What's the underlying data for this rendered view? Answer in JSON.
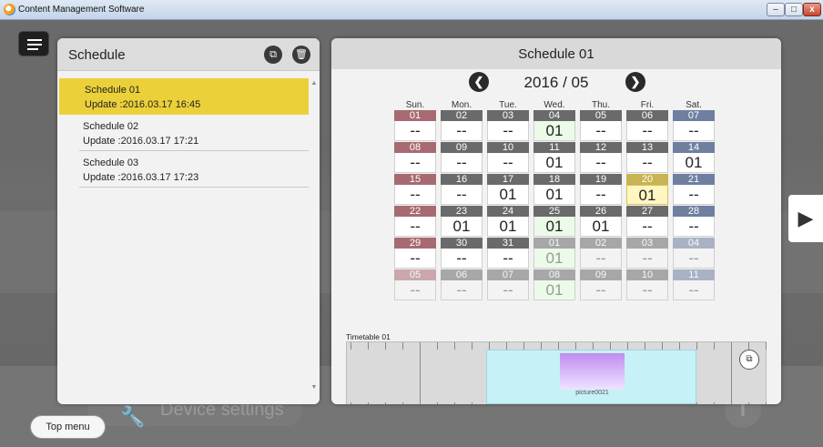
{
  "window": {
    "title": "Content Management Software",
    "minimize": "–",
    "maximize": "□",
    "close": "x"
  },
  "icons": {
    "app": "app-logo-icon",
    "menu": "hamburger-menu-icon",
    "copy": "copy-icon",
    "delete": "trash-icon",
    "prev": "chevron-left-icon",
    "next": "chevron-right-icon",
    "expand": "expand-icon",
    "panel_next": "play-right-icon",
    "wrench": "wrench-icon",
    "info": "info-icon"
  },
  "schedule_panel": {
    "title": "Schedule",
    "copy_glyph": "⧉",
    "delete_glyph": "🗑",
    "items": [
      {
        "name": "Schedule 01",
        "update": "Update :2016.03.17  16:45",
        "selected": true
      },
      {
        "name": "Schedule 02",
        "update": "Update :2016.03.17  17:21",
        "selected": false
      },
      {
        "name": "Schedule 03",
        "update": "Update :2016.03.17  17:23",
        "selected": false
      }
    ]
  },
  "detail_panel": {
    "title": "Schedule 01",
    "month": "2016 / 05",
    "prev_glyph": "❮",
    "next_glyph": "❯",
    "weekdays": [
      "Sun.",
      "Mon.",
      "Tue.",
      "Wed.",
      "Thu.",
      "Fri.",
      "Sat."
    ],
    "weeks": [
      [
        {
          "d": "01",
          "v": "--",
          "m": "cur"
        },
        {
          "d": "02",
          "v": "--",
          "m": "cur"
        },
        {
          "d": "03",
          "v": "--",
          "m": "cur"
        },
        {
          "d": "04",
          "v": "01",
          "m": "cur",
          "green": true
        },
        {
          "d": "05",
          "v": "--",
          "m": "cur"
        },
        {
          "d": "06",
          "v": "--",
          "m": "cur"
        },
        {
          "d": "07",
          "v": "--",
          "m": "cur"
        }
      ],
      [
        {
          "d": "08",
          "v": "--",
          "m": "cur"
        },
        {
          "d": "09",
          "v": "--",
          "m": "cur"
        },
        {
          "d": "10",
          "v": "--",
          "m": "cur"
        },
        {
          "d": "11",
          "v": "01",
          "m": "cur"
        },
        {
          "d": "12",
          "v": "--",
          "m": "cur"
        },
        {
          "d": "13",
          "v": "--",
          "m": "cur"
        },
        {
          "d": "14",
          "v": "01",
          "m": "cur"
        }
      ],
      [
        {
          "d": "15",
          "v": "--",
          "m": "cur"
        },
        {
          "d": "16",
          "v": "--",
          "m": "cur"
        },
        {
          "d": "17",
          "v": "01",
          "m": "cur"
        },
        {
          "d": "18",
          "v": "01",
          "m": "cur"
        },
        {
          "d": "19",
          "v": "--",
          "m": "cur"
        },
        {
          "d": "20",
          "v": "01",
          "m": "cur",
          "today": true
        },
        {
          "d": "21",
          "v": "--",
          "m": "cur"
        }
      ],
      [
        {
          "d": "22",
          "v": "--",
          "m": "cur"
        },
        {
          "d": "23",
          "v": "01",
          "m": "cur"
        },
        {
          "d": "24",
          "v": "01",
          "m": "cur"
        },
        {
          "d": "25",
          "v": "01",
          "m": "cur",
          "green": true
        },
        {
          "d": "26",
          "v": "01",
          "m": "cur"
        },
        {
          "d": "27",
          "v": "--",
          "m": "cur"
        },
        {
          "d": "28",
          "v": "--",
          "m": "cur"
        }
      ],
      [
        {
          "d": "29",
          "v": "--",
          "m": "cur"
        },
        {
          "d": "30",
          "v": "--",
          "m": "cur"
        },
        {
          "d": "31",
          "v": "--",
          "m": "cur"
        },
        {
          "d": "01",
          "v": "01",
          "m": "next",
          "green": true
        },
        {
          "d": "02",
          "v": "--",
          "m": "next"
        },
        {
          "d": "03",
          "v": "--",
          "m": "next"
        },
        {
          "d": "04",
          "v": "--",
          "m": "next"
        }
      ],
      [
        {
          "d": "05",
          "v": "--",
          "m": "next"
        },
        {
          "d": "06",
          "v": "--",
          "m": "next"
        },
        {
          "d": "07",
          "v": "--",
          "m": "next"
        },
        {
          "d": "08",
          "v": "01",
          "m": "next",
          "green": true
        },
        {
          "d": "09",
          "v": "--",
          "m": "next"
        },
        {
          "d": "10",
          "v": "--",
          "m": "next"
        },
        {
          "d": "11",
          "v": "--",
          "m": "next"
        }
      ]
    ],
    "timetable": {
      "label": "Timetable 01",
      "content_name": "picture0021",
      "expand_glyph": "⧉"
    }
  },
  "right_arrow_glyph": "▶",
  "device_settings": {
    "label": "Device settings",
    "wrench_glyph": "🔧"
  },
  "info_glyph": "i",
  "top_menu": {
    "label": "Top menu"
  },
  "colors": {
    "selected": "#ebd03a",
    "sun_header": "#a86a72",
    "weekday_header": "#6a6a6a",
    "sat_header": "#6f7fa0",
    "today_bg": "#fff6c0",
    "today_header": "#c8b454",
    "green_bg": "#ecfbe8",
    "next_month_header": "#b4b4b4"
  }
}
